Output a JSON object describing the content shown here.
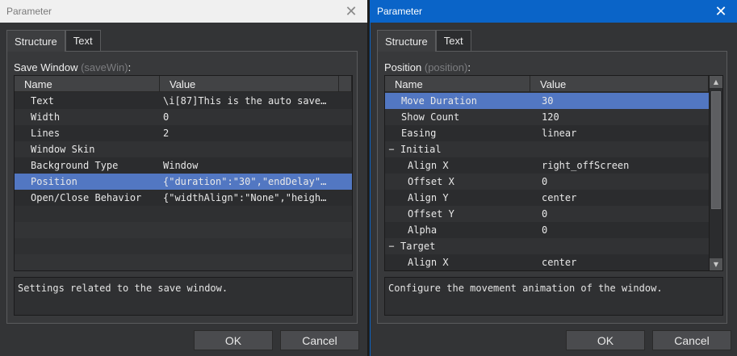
{
  "left": {
    "title": "Parameter",
    "close_glyph": "✕",
    "tabs": [
      "Structure",
      "Text"
    ],
    "section": {
      "label": "Save Window ",
      "paren": "(saveWin)",
      "colon": ":"
    },
    "columns": [
      "Name",
      "Value"
    ],
    "rows": [
      {
        "name": "Text",
        "value": "\\i[87]This is the auto save…"
      },
      {
        "name": "Width",
        "value": "0"
      },
      {
        "name": "Lines",
        "value": "2"
      },
      {
        "name": "Window Skin",
        "value": ""
      },
      {
        "name": "Background Type",
        "value": "Window"
      },
      {
        "name": "Position",
        "value": "{\"duration\":\"30\",\"endDelay\"…"
      },
      {
        "name": "Open/Close Behavior",
        "value": "{\"widthAlign\":\"None\",\"heigh…"
      }
    ],
    "description": "Settings related to the save window.",
    "ok_label": "OK",
    "cancel_label": "Cancel"
  },
  "right": {
    "title": "Parameter",
    "close_glyph": "✕",
    "tabs": [
      "Structure",
      "Text"
    ],
    "section": {
      "label": "Position ",
      "paren": "(position)",
      "colon": ":"
    },
    "columns": [
      "Name",
      "Value"
    ],
    "rows": [
      {
        "name": "Move Duration",
        "value": "30"
      },
      {
        "name": "Show Count",
        "value": "120"
      },
      {
        "name": "Easing",
        "value": "linear"
      },
      {
        "name": "Initial",
        "value": "",
        "expander": "−"
      },
      {
        "name": "Align X",
        "value": "right_offScreen"
      },
      {
        "name": "Offset X",
        "value": "0"
      },
      {
        "name": "Align Y",
        "value": "center"
      },
      {
        "name": "Offset Y",
        "value": "0"
      },
      {
        "name": "Alpha",
        "value": "0"
      },
      {
        "name": "Target",
        "value": "",
        "expander": "−"
      },
      {
        "name": "Align X",
        "value": "center"
      }
    ],
    "description": "Configure the movement animation of the window.",
    "ok_label": "OK",
    "cancel_label": "Cancel"
  },
  "colors": {
    "selection": "#5277c2",
    "active_titlebar": "#0a64c8",
    "inactive_titlebar": "#f0f0f0",
    "window_bg": "#333436"
  }
}
